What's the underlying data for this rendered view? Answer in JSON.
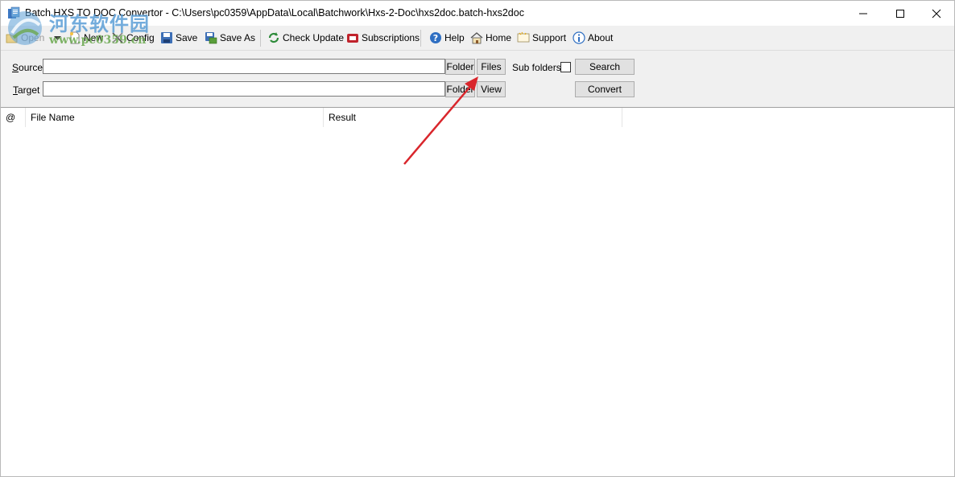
{
  "window": {
    "title": "Batch HXS TO DOC Convertor - C:\\Users\\pc0359\\AppData\\Local\\Batchwork\\Hxs-2-Doc\\hxs2doc.batch-hxs2doc"
  },
  "watermark": {
    "site_name": "河东软件园",
    "url": "www.pc0359.cn"
  },
  "toolbar": {
    "open_label": "Open",
    "new_label": "New",
    "config_label": "Config",
    "save_label": "Save",
    "save_as_label": "Save As",
    "check_update_label": "Check Update",
    "subscriptions_label": "Subscriptions",
    "help_label": "Help",
    "home_label": "Home",
    "support_label": "Support",
    "about_label": "About"
  },
  "form": {
    "source_label_u": "S",
    "source_label_rest": "ource",
    "target_label_u": "T",
    "target_label_rest": "arget",
    "source_value": "",
    "target_value": "",
    "source_folder_button": "Folder",
    "files_button": "Files",
    "target_folder_button": "Folder",
    "view_button": "View",
    "subfolders_label": "Sub folders",
    "subfolders_checked": false,
    "search_button": "Search",
    "convert_button": "Convert"
  },
  "list": {
    "columns": [
      "@",
      "File Name",
      "Result"
    ],
    "rows": []
  },
  "colors": {
    "arrow": "#d9262c",
    "panel_bg": "#f0f0f0",
    "button_bg": "#e1e1e1"
  }
}
